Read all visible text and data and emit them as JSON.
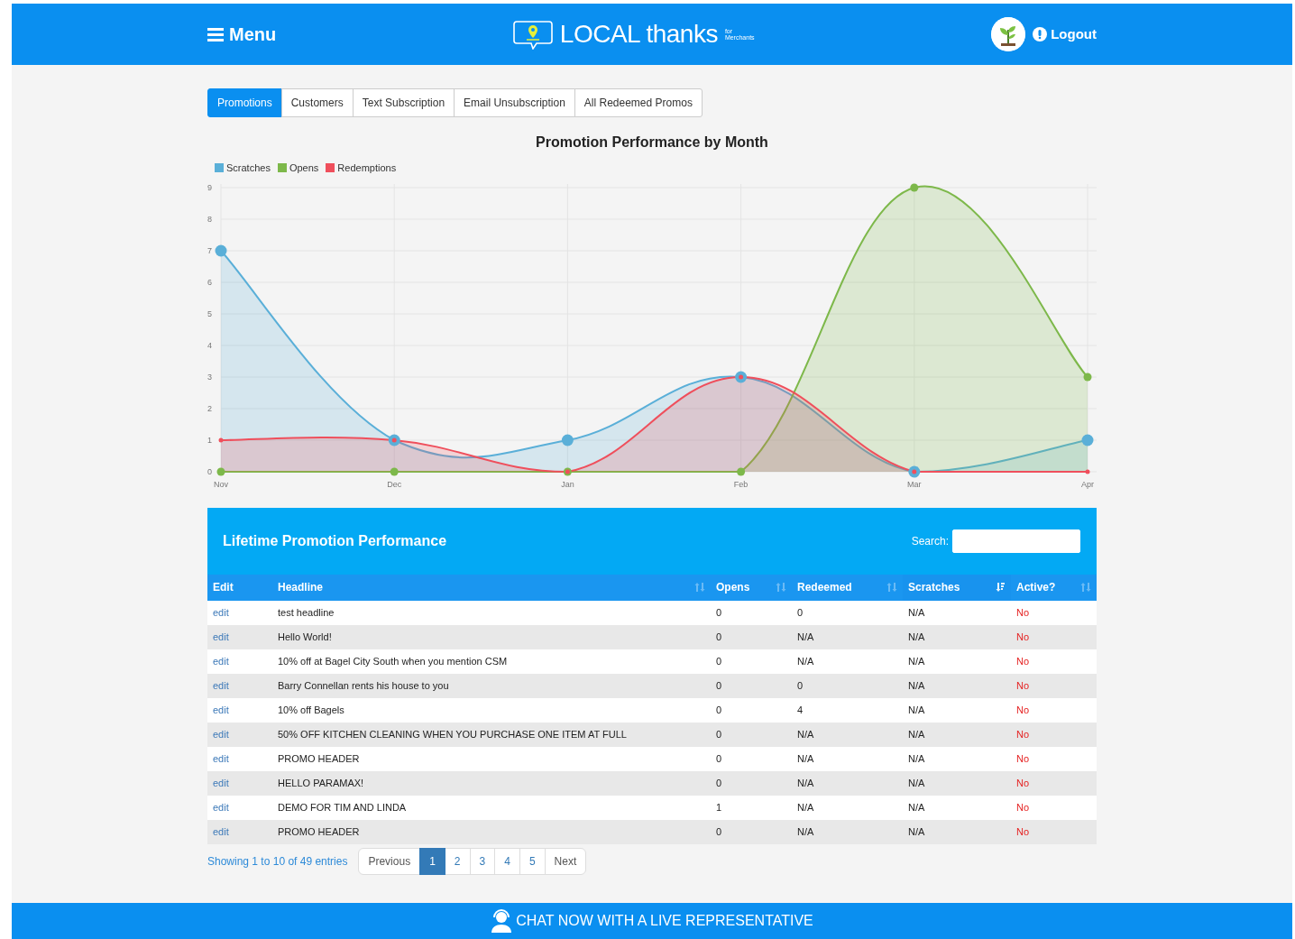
{
  "header": {
    "menu_label": "Menu",
    "logo_text": "LOCAL thanks",
    "logo_small_top": "for",
    "logo_small_bottom": "Merchants",
    "logout_label": "Logout"
  },
  "tabs": [
    {
      "label": "Promotions",
      "selected": true
    },
    {
      "label": "Customers",
      "selected": false
    },
    {
      "label": "Text Subscription",
      "selected": false
    },
    {
      "label": "Email Unsubscription",
      "selected": false
    },
    {
      "label": "All Redeemed Promos",
      "selected": false
    }
  ],
  "chart": {
    "chart_data": {
      "type": "area",
      "grid": true,
      "title": "Promotion Performance by Month",
      "categories": [
        "Nov",
        "Dec",
        "Jan",
        "Feb",
        "Mar",
        "Apr"
      ],
      "ylim": [
        0,
        9
      ],
      "yticks": [
        0,
        1,
        2,
        3,
        4,
        5,
        6,
        7,
        8,
        9
      ],
      "series": [
        {
          "name": "Scratches",
          "color": "#5aafd8",
          "values": [
            7,
            1,
            1,
            3,
            0,
            1
          ]
        },
        {
          "name": "Opens",
          "color": "#7db84a",
          "values": [
            0,
            0,
            0,
            0,
            9,
            3
          ]
        },
        {
          "name": "Redemptions",
          "color": "#ef4f5c",
          "values": [
            1,
            1,
            0,
            3,
            0,
            0
          ]
        }
      ]
    }
  },
  "table_panel": {
    "title": "Lifetime Promotion Performance",
    "search_label": "Search:",
    "columns": [
      {
        "label": "Edit",
        "sortable": false
      },
      {
        "label": "Headline",
        "sortable": true,
        "selected": false
      },
      {
        "label": "Opens",
        "sortable": true,
        "selected": false
      },
      {
        "label": "Redeemed",
        "sortable": true,
        "selected": false
      },
      {
        "label": "Scratches",
        "sortable": true,
        "selected": true
      },
      {
        "label": "Active?",
        "sortable": true,
        "selected": false
      }
    ],
    "rows": [
      {
        "edit": "edit",
        "headline": "test headline",
        "opens": "0",
        "redeemed": "0",
        "scratches": "N/A",
        "active": "No"
      },
      {
        "edit": "edit",
        "headline": "Hello World!",
        "opens": "0",
        "redeemed": "N/A",
        "scratches": "N/A",
        "active": "No"
      },
      {
        "edit": "edit",
        "headline": "10% off at Bagel City South when you mention CSM",
        "opens": "0",
        "redeemed": "N/A",
        "scratches": "N/A",
        "active": "No"
      },
      {
        "edit": "edit",
        "headline": "Barry Connellan rents his house to you",
        "opens": "0",
        "redeemed": "0",
        "scratches": "N/A",
        "active": "No"
      },
      {
        "edit": "edit",
        "headline": "10% off Bagels",
        "opens": "0",
        "redeemed": "4",
        "scratches": "N/A",
        "active": "No"
      },
      {
        "edit": "edit",
        "headline": "50% OFF KITCHEN CLEANING WHEN YOU PURCHASE ONE ITEM AT FULL",
        "opens": "0",
        "redeemed": "N/A",
        "scratches": "N/A",
        "active": "No"
      },
      {
        "edit": "edit",
        "headline": "PROMO HEADER",
        "opens": "0",
        "redeemed": "N/A",
        "scratches": "N/A",
        "active": "No"
      },
      {
        "edit": "edit",
        "headline": "HELLO PARAMAX!",
        "opens": "0",
        "redeemed": "N/A",
        "scratches": "N/A",
        "active": "No"
      },
      {
        "edit": "edit",
        "headline": "DEMO FOR TIM AND LINDA",
        "opens": "1",
        "redeemed": "N/A",
        "scratches": "N/A",
        "active": "No"
      },
      {
        "edit": "edit",
        "headline": "PROMO HEADER",
        "opens": "0",
        "redeemed": "N/A",
        "scratches": "N/A",
        "active": "No"
      }
    ],
    "info": "Showing 1 to 10 of 49 entries",
    "pagination": {
      "previous": "Previous",
      "next": "Next",
      "pages": [
        {
          "label": "1",
          "selected": true
        },
        {
          "label": "2",
          "selected": false
        },
        {
          "label": "3",
          "selected": false
        },
        {
          "label": "4",
          "selected": false
        },
        {
          "label": "5",
          "selected": false
        }
      ]
    }
  },
  "footer": {
    "chat_label": "CHAT NOW WITH A LIVE REPRESENTATIVE"
  }
}
